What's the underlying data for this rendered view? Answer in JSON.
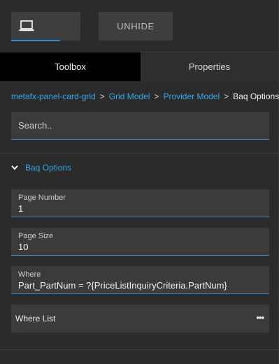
{
  "toolbar": {
    "device_icon": "laptop-icon",
    "unhide_label": "UNHIDE"
  },
  "tabs": [
    {
      "label": "Toolbox",
      "active": true
    },
    {
      "label": "Properties",
      "active": false
    }
  ],
  "breadcrumb": {
    "items": [
      "metafx-panel-card-grid",
      "Grid Model",
      "Provider Model"
    ],
    "current": "Baq Options",
    "separator": ">"
  },
  "search": {
    "placeholder": "Search..",
    "value": ""
  },
  "section": {
    "title": "Baq Options",
    "expanded": true,
    "icon": "chevron-down-icon"
  },
  "fields": [
    {
      "label": "Page Number",
      "value": "1"
    },
    {
      "label": "Page Size",
      "value": "10"
    },
    {
      "label": "Where",
      "value": "Part_PartNum = ?{PriceListInquiryCriteria.PartNum}"
    }
  ],
  "where_list": {
    "label": "Where List",
    "more": "•••"
  },
  "colors": {
    "accent": "#2f8fd1",
    "link": "#37a6e8",
    "background": "#2b2b2b",
    "field_bg": "#3b3b3b",
    "active_tab": "#000000"
  }
}
